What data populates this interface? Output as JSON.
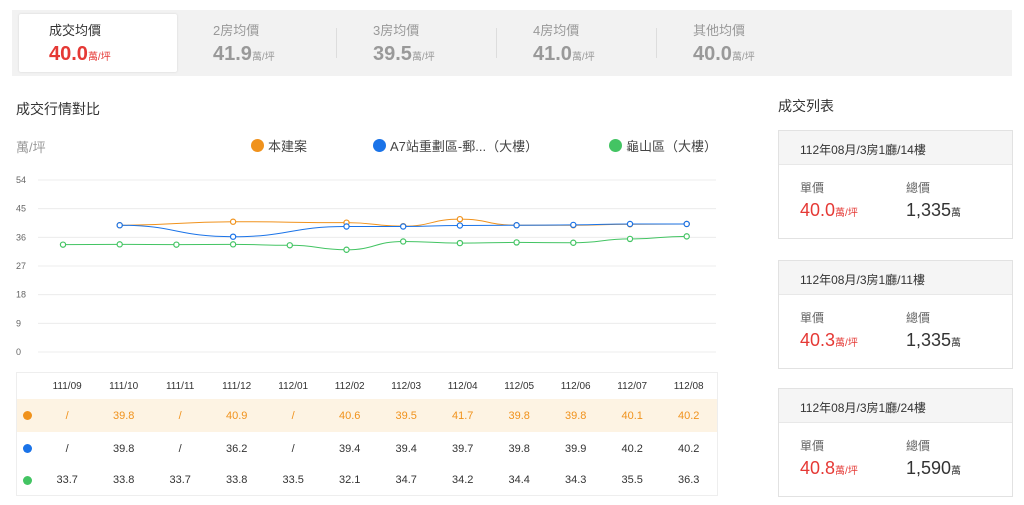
{
  "tabs": [
    {
      "label": "成交均價",
      "value": "40.0",
      "unit": "萬/坪"
    },
    {
      "label": "2房均價",
      "value": "41.9",
      "unit": "萬/坪"
    },
    {
      "label": "3房均價",
      "value": "39.5",
      "unit": "萬/坪"
    },
    {
      "label": "4房均價",
      "value": "41.0",
      "unit": "萬/坪"
    },
    {
      "label": "其他均價",
      "value": "40.0",
      "unit": "萬/坪"
    }
  ],
  "section": {
    "compare_title": "成交行情對比",
    "list_title": "成交列表"
  },
  "chart": {
    "unit_label": "萬/坪"
  },
  "legend": [
    {
      "name": "本建案",
      "color": "#f0921c"
    },
    {
      "name": "A7站重劃區-郵...（大樓）",
      "color": "#1a73e8"
    },
    {
      "name": "龜山區（大樓）",
      "color": "#43c463"
    }
  ],
  "chart_data": {
    "type": "line",
    "x": [
      "111/09",
      "111/10",
      "111/11",
      "111/12",
      "112/01",
      "112/02",
      "112/03",
      "112/04",
      "112/05",
      "112/06",
      "112/07",
      "112/08"
    ],
    "ylim": [
      0,
      54
    ],
    "yticks": [
      "54",
      "45",
      "36",
      "27",
      "18",
      "9",
      "0"
    ],
    "grid": true,
    "legend_position": "top",
    "series": [
      {
        "name": "本建案",
        "color": "#f0921c",
        "values": [
          null,
          39.8,
          null,
          40.9,
          null,
          40.6,
          39.5,
          41.7,
          39.8,
          39.8,
          40.1,
          40.2
        ]
      },
      {
        "name": "A7站重劃區-郵...（大樓）",
        "color": "#1a73e8",
        "values": [
          null,
          39.8,
          null,
          36.2,
          null,
          39.4,
          39.4,
          39.7,
          39.8,
          39.9,
          40.2,
          40.2
        ]
      },
      {
        "name": "龜山區（大樓）",
        "color": "#43c463",
        "values": [
          33.7,
          33.8,
          33.7,
          33.8,
          33.5,
          32.1,
          34.7,
          34.2,
          34.4,
          34.3,
          35.5,
          36.3
        ]
      }
    ]
  },
  "table": {
    "rows": [
      {
        "color": "#f0921c",
        "cells": [
          "/",
          "39.8",
          "/",
          "40.9",
          "/",
          "40.6",
          "39.5",
          "41.7",
          "39.8",
          "39.8",
          "40.1",
          "40.2"
        ]
      },
      {
        "color": "#1a73e8",
        "cells": [
          "/",
          "39.8",
          "/",
          "36.2",
          "/",
          "39.4",
          "39.4",
          "39.7",
          "39.8",
          "39.9",
          "40.2",
          "40.2"
        ]
      },
      {
        "color": "#43c463",
        "cells": [
          "33.7",
          "33.8",
          "33.7",
          "33.8",
          "33.5",
          "32.1",
          "34.7",
          "34.2",
          "34.4",
          "34.3",
          "35.5",
          "36.3"
        ]
      }
    ]
  },
  "transactions": [
    {
      "title": "112年08月/3房1廳/14樓",
      "price_label": "單價",
      "price": "40.0",
      "price_unit": "萬/坪",
      "total_label": "總價",
      "total": "1,335",
      "total_unit": "萬"
    },
    {
      "title": "112年08月/3房1廳/11樓",
      "price_label": "單價",
      "price": "40.3",
      "price_unit": "萬/坪",
      "total_label": "總價",
      "total": "1,335",
      "total_unit": "萬"
    },
    {
      "title": "112年08月/3房1廳/24樓",
      "price_label": "單價",
      "price": "40.8",
      "price_unit": "萬/坪",
      "total_label": "總價",
      "total": "1,590",
      "total_unit": "萬"
    }
  ]
}
